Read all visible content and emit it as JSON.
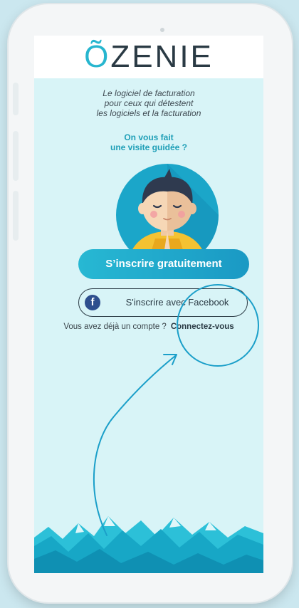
{
  "brand": {
    "logo_first": "Õ",
    "logo_rest": "ZENIE"
  },
  "intro": {
    "tagline_line1": "Le logiciel de facturation",
    "tagline_line2": "pour ceux qui détestent",
    "tagline_line3": "les logiciels et la facturation",
    "tour_line1": "On vous fait",
    "tour_line2": "une visite guidée ?"
  },
  "actions": {
    "signup_label": "S’inscrire gratuitement",
    "facebook_label": "S'inscrire avec Facebook",
    "facebook_icon": "facebook-icon",
    "facebook_letter": "f",
    "have_account_text": "Vous avez déjà un compte ?",
    "login_link": "Connectez-vous"
  },
  "colors": {
    "accent": "#27b6cf",
    "screen_bg": "#d8f4f7",
    "text_dark": "#2a3a44",
    "annotation": "#1b9fc9"
  }
}
